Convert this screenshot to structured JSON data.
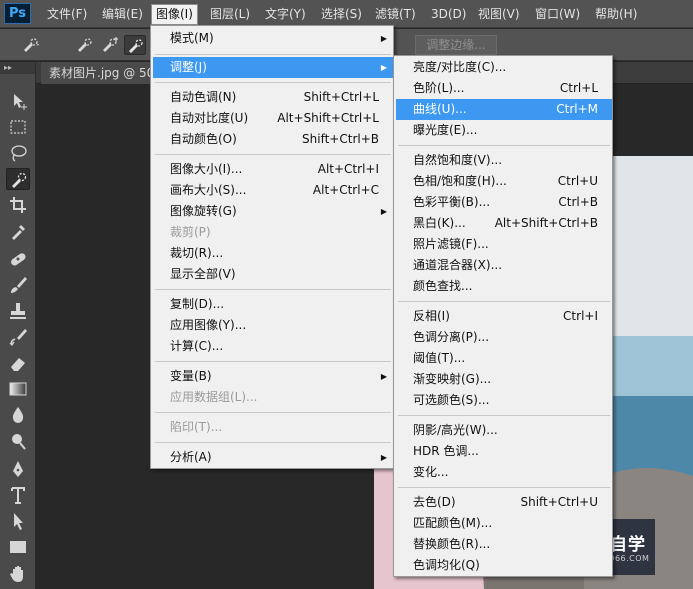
{
  "app": {
    "logo": "Ps"
  },
  "menubar": {
    "items": [
      "文件(F)",
      "编辑(E)",
      "图像(I)",
      "图层(L)",
      "文字(Y)",
      "选择(S)",
      "滤镜(T)",
      "3D(D)",
      "视图(V)",
      "窗口(W)",
      "帮助(H)"
    ],
    "active": "图像(I)"
  },
  "options_bar": {
    "refine_edge": "调整边缘..."
  },
  "document": {
    "tab_title": "素材图片.jpg @ 50"
  },
  "image_menu": {
    "items": [
      {
        "label": "模式(M)",
        "shortcut": "",
        "submenu": true
      },
      {
        "label": "调整(J)",
        "shortcut": "",
        "submenu": true,
        "highlighted": true
      },
      {
        "label": "自动色调(N)",
        "shortcut": "Shift+Ctrl+L"
      },
      {
        "label": "自动对比度(U)",
        "shortcut": "Alt+Shift+Ctrl+L"
      },
      {
        "label": "自动颜色(O)",
        "shortcut": "Shift+Ctrl+B"
      },
      {
        "label": "图像大小(I)...",
        "shortcut": "Alt+Ctrl+I"
      },
      {
        "label": "画布大小(S)...",
        "shortcut": "Alt+Ctrl+C"
      },
      {
        "label": "图像旋转(G)",
        "shortcut": "",
        "submenu": true
      },
      {
        "label": "裁剪(P)",
        "shortcut": "",
        "disabled": true
      },
      {
        "label": "裁切(R)...",
        "shortcut": ""
      },
      {
        "label": "显示全部(V)",
        "shortcut": ""
      },
      {
        "label": "复制(D)...",
        "shortcut": ""
      },
      {
        "label": "应用图像(Y)...",
        "shortcut": ""
      },
      {
        "label": "计算(C)...",
        "shortcut": ""
      },
      {
        "label": "变量(B)",
        "shortcut": "",
        "submenu": true
      },
      {
        "label": "应用数据组(L)...",
        "shortcut": "",
        "disabled": true
      },
      {
        "label": "陷印(T)...",
        "shortcut": "",
        "disabled": true
      },
      {
        "label": "分析(A)",
        "shortcut": "",
        "submenu": true
      }
    ]
  },
  "adjust_menu": {
    "items": [
      {
        "label": "亮度/对比度(C)...",
        "shortcut": ""
      },
      {
        "label": "色阶(L)...",
        "shortcut": "Ctrl+L"
      },
      {
        "label": "曲线(U)...",
        "shortcut": "Ctrl+M",
        "highlighted": true
      },
      {
        "label": "曝光度(E)...",
        "shortcut": ""
      },
      {
        "label": "自然饱和度(V)...",
        "shortcut": ""
      },
      {
        "label": "色相/饱和度(H)...",
        "shortcut": "Ctrl+U"
      },
      {
        "label": "色彩平衡(B)...",
        "shortcut": "Ctrl+B"
      },
      {
        "label": "黑白(K)...",
        "shortcut": "Alt+Shift+Ctrl+B"
      },
      {
        "label": "照片滤镜(F)...",
        "shortcut": ""
      },
      {
        "label": "通道混合器(X)...",
        "shortcut": ""
      },
      {
        "label": "颜色查找...",
        "shortcut": ""
      },
      {
        "label": "反相(I)",
        "shortcut": "Ctrl+I"
      },
      {
        "label": "色调分离(P)...",
        "shortcut": ""
      },
      {
        "label": "阈值(T)...",
        "shortcut": ""
      },
      {
        "label": "渐变映射(G)...",
        "shortcut": ""
      },
      {
        "label": "可选颜色(S)...",
        "shortcut": ""
      },
      {
        "label": "阴影/高光(W)...",
        "shortcut": ""
      },
      {
        "label": "HDR 色调...",
        "shortcut": ""
      },
      {
        "label": "变化...",
        "shortcut": ""
      },
      {
        "label": "去色(D)",
        "shortcut": "Shift+Ctrl+U"
      },
      {
        "label": "匹配颜色(M)...",
        "shortcut": ""
      },
      {
        "label": "替换颜色(R)...",
        "shortcut": ""
      },
      {
        "label": "色调均化(Q)",
        "shortcut": ""
      }
    ]
  },
  "watermark": {
    "title": "溜溜自学",
    "url": "ZIXUE.3066.COM"
  },
  "colors": {
    "highlight": "#3d98f2",
    "menu_bg": "#f0f0f0",
    "ui_dark": "#535353"
  }
}
